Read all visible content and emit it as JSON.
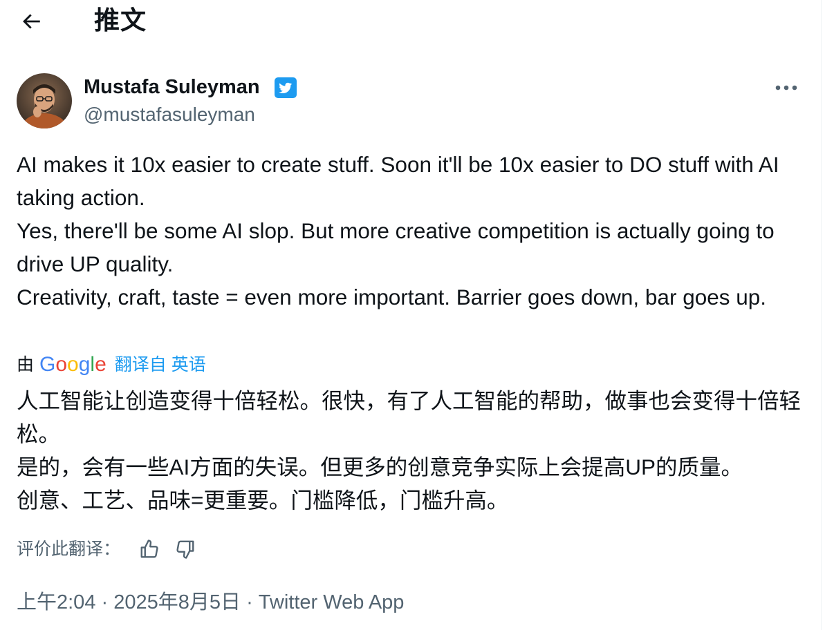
{
  "header": {
    "title": "推文"
  },
  "author": {
    "name": "Mustafa Suleyman",
    "handle": "@mustafasuleyman",
    "verified": true
  },
  "tweet": {
    "paragraphs": [
      "AI makes it 10x easier to create stuff. Soon it'll be 10x easier to DO stuff with AI taking action.",
      "Yes, there'll be some AI slop. But more creative competition is actually going to drive UP quality.",
      "Creativity, craft, taste = even more important. Barrier goes down, bar goes up."
    ]
  },
  "translation": {
    "by_label": "由",
    "provider": "Google",
    "translated_from": "翻译自 英语",
    "paragraphs": [
      "人工智能让创造变得十倍轻松。很快，有了人工智能的帮助，做事也会变得十倍轻松。",
      "是的，会有一些AI方面的失误。但更多的创意竞争实际上会提高UP的质量。",
      "创意、工艺、品味=更重要。门槛降低，门槛升高。"
    ],
    "rate_label": "评价此翻译："
  },
  "meta": {
    "time": "上午2:04",
    "separator1": " · ",
    "date": "2025年8月5日",
    "separator2": " · ",
    "source": "Twitter Web App"
  },
  "icons": {
    "back": "arrow-left-icon",
    "verified": "verified-badge-icon",
    "more": "more-horizontal-icon",
    "thumbs_up": "thumbs-up-icon",
    "thumbs_down": "thumbs-down-icon"
  },
  "colors": {
    "accent": "#1d9bf0",
    "text": "#0f1419",
    "secondary": "#536471",
    "google_blue": "#4285F4",
    "google_red": "#EA4335",
    "google_yellow": "#FBBC05",
    "google_green": "#34A853"
  }
}
